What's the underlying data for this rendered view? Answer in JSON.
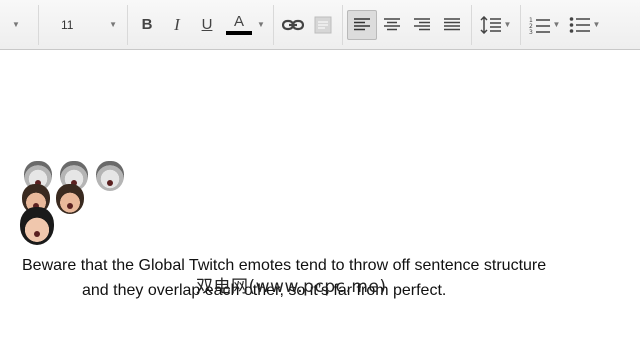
{
  "toolbar": {
    "font_size": "11",
    "bold_label": "B",
    "italic_label": "I",
    "underline_label": "U",
    "text_color_label": "A",
    "text_color_value": "#000000",
    "icons": [
      "link-icon",
      "comment-icon",
      "align-left-icon",
      "align-center-icon",
      "align-right-icon",
      "justify-icon",
      "line-spacing-icon",
      "numbered-list-icon",
      "bulleted-list-icon"
    ]
  },
  "document": {
    "emotes": [
      "grey-emote",
      "grey-emote",
      "grey-emote",
      "color-emote",
      "color-emote",
      "large-emote"
    ],
    "caption_line1": "Beware that the Global Twitch emotes tend to throw off sentence structure",
    "caption_line2": "and they overlap each other, so it’s far from perfect.",
    "watermark": "双电网(www.pcpc.me)"
  }
}
